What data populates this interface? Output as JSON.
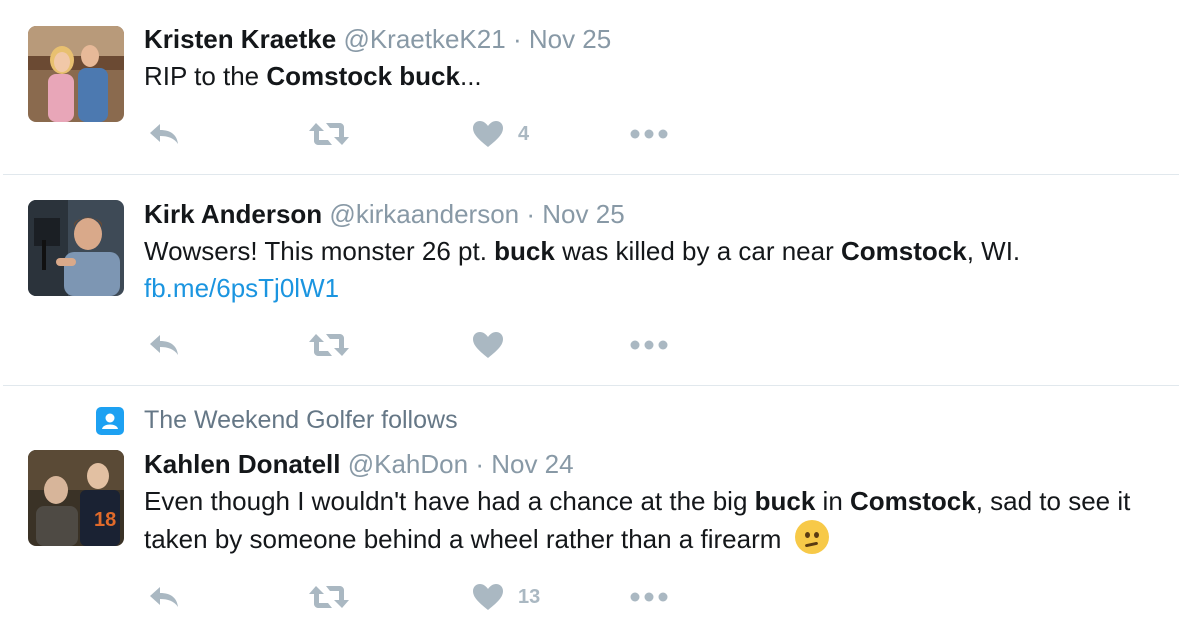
{
  "tweets": [
    {
      "name": "Kristen Kraetke",
      "handle": "@KraetkeK21",
      "separator": "·",
      "date": "Nov 25",
      "text": [
        {
          "t": "RIP to the "
        },
        {
          "t": "Comstock buck",
          "bold": true
        },
        {
          "t": "..."
        }
      ],
      "like_count": "4"
    },
    {
      "name": "Kirk Anderson",
      "handle": "@kirkaanderson",
      "separator": "·",
      "date": "Nov 25",
      "text": [
        {
          "t": "Wowsers! This monster 26 pt. "
        },
        {
          "t": "buck",
          "bold": true
        },
        {
          "t": " was killed by a car near "
        },
        {
          "t": "Comstock",
          "bold": true
        },
        {
          "t": ", WI."
        }
      ],
      "link": "fb.me/6psTj0lW1",
      "like_count": ""
    },
    {
      "context": "The Weekend Golfer follows",
      "name": "Kahlen Donatell",
      "handle": "@KahDon",
      "separator": "·",
      "date": "Nov 24",
      "text": [
        {
          "t": "Even though I wouldn't have had a chance at the big "
        },
        {
          "t": "buck",
          "bold": true
        },
        {
          "t": " in "
        },
        {
          "t": "Comstock",
          "bold": true
        },
        {
          "t": ", sad to see it taken by someone behind a wheel rather than a firearm"
        }
      ],
      "emoji": "confused-face",
      "like_count": "13"
    }
  ],
  "colors": {
    "link": "#1b95e0",
    "meta": "#8899a6",
    "action_icon": "#aab8c2",
    "context_badge": "#1da1f2",
    "divider": "#e1e8ed"
  },
  "icons": [
    "reply-icon",
    "retweet-icon",
    "heart-icon",
    "more-icon",
    "follow-context-icon",
    "confused-face-emoji"
  ]
}
